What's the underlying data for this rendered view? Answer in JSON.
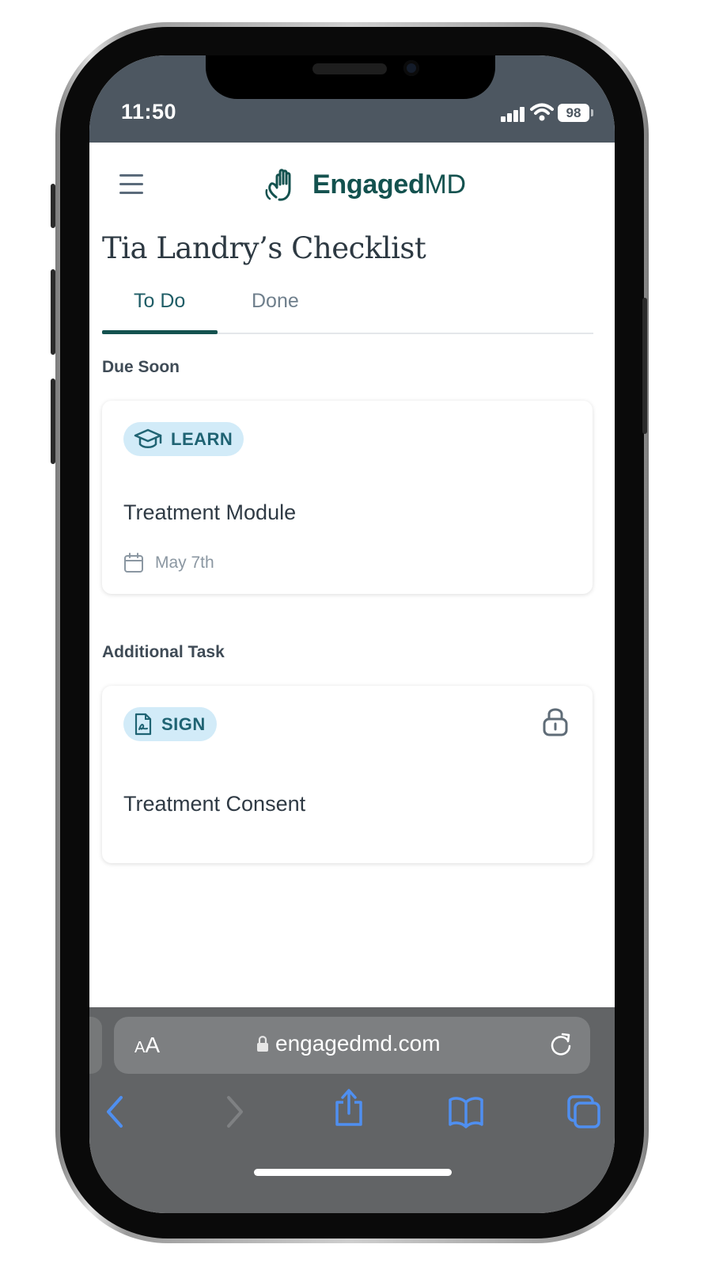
{
  "status_bar": {
    "time": "11:50",
    "battery": "98",
    "signal_icon": "cellular-signal-icon",
    "wifi_icon": "wifi-icon"
  },
  "header": {
    "menu_icon": "hamburger-menu-icon",
    "logo_icon": "waving-hand-icon",
    "logo_bold": "Engaged",
    "logo_light": "MD",
    "brand_color": "#14524f"
  },
  "page": {
    "title": "Tia Landry’s Checklist"
  },
  "tabs": [
    {
      "label": "To Do",
      "active": true
    },
    {
      "label": "Done",
      "active": false
    }
  ],
  "sections": {
    "due_soon": {
      "label": "Due Soon",
      "card": {
        "badge": "LEARN",
        "badge_icon": "graduation-cap-icon",
        "title": "Treatment Module",
        "due_icon": "calendar-icon",
        "due_date": "May 7th"
      }
    },
    "additional": {
      "label": "Additional Task",
      "card": {
        "badge": "SIGN",
        "badge_icon": "signature-document-icon",
        "title": "Treatment Consent",
        "status_icon": "lock-icon"
      }
    }
  },
  "browser": {
    "text_size_big": "A",
    "text_size_small": "A",
    "lock_icon": "lock-icon",
    "url": "engagedmd.com",
    "reload_icon": "reload-icon",
    "toolbar_icons": [
      "back-icon",
      "forward-icon",
      "share-icon",
      "bookmarks-icon",
      "tabs-icon"
    ]
  },
  "colors": {
    "status_bar_bg": "#4d5761",
    "badge_bg": "#d2ebf8",
    "badge_text": "#1f6373",
    "safari_bg": "#626466",
    "safari_accent": "#4f8ff0"
  }
}
